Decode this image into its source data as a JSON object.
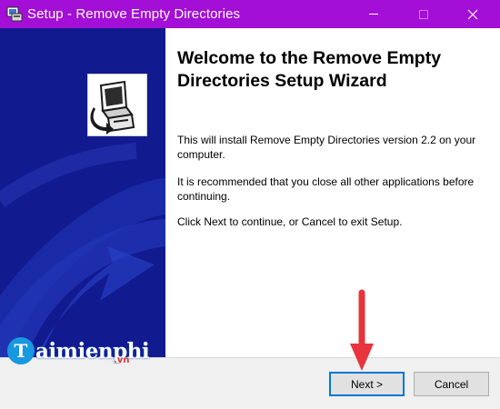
{
  "window": {
    "title": "Setup - Remove Empty Directories",
    "controls": [
      "minimize-icon",
      "maximize-icon",
      "close-icon"
    ]
  },
  "wizard": {
    "heading": "Welcome to the Remove Empty Directories Setup Wizard",
    "paragraphs": [
      "This will install Remove Empty Directories version 2.2 on your computer.",
      "It is recommended that you close all other applications before continuing.",
      "Click Next to continue, or Cancel to exit Setup."
    ]
  },
  "buttons": {
    "next": "Next >",
    "cancel": "Cancel"
  },
  "watermark": {
    "brand_initial": "T",
    "brand": "aimienphi",
    "suffix": ".vn"
  },
  "colors": {
    "titlebar": "#a30fd6",
    "side_panel": "#111a8f",
    "focus_border": "#0078d7",
    "annotation_arrow": "#e8343d"
  }
}
